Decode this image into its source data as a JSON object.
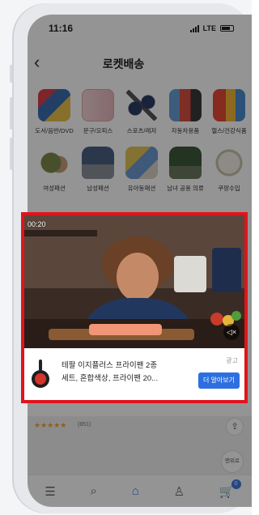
{
  "status_bar": {
    "time": "11:16",
    "network": "LTE"
  },
  "header": {
    "title": "로켓배송"
  },
  "categories": [
    {
      "label": "도서/음반/DVD"
    },
    {
      "label": "문구/오피스"
    },
    {
      "label": "스포츠/레저"
    },
    {
      "label": "자동차용품"
    },
    {
      "label": "헬스/건강식품"
    },
    {
      "label": "여성패션"
    },
    {
      "label": "남성패션"
    },
    {
      "label": "유아동패션"
    },
    {
      "label": "남녀 공용 의류"
    },
    {
      "label": "쿠팡수입"
    }
  ],
  "product_below": {
    "stars": "★★★★★",
    "review_count": "(851)"
  },
  "scroll_top_label": "맨위로",
  "bottom_nav": {
    "cart_count": "0"
  },
  "ad": {
    "timer": "00:20",
    "title_line1": "테팔 이지플러스 프라이팬 2종",
    "title_line2": "세트, 혼합색상, 프라이팬 20...",
    "ad_label": "광고",
    "cta_label": "더 알아보기"
  },
  "colors": {
    "highlight_border": "#e0141c",
    "cta": "#2d6fe0",
    "accent": "#3f7be6"
  }
}
